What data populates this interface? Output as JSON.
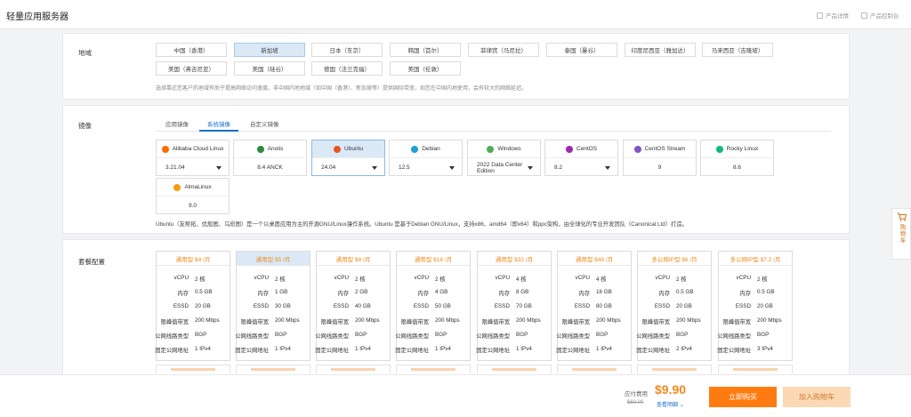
{
  "header": {
    "title": "轻量应用服务器",
    "links": [
      "产品详情",
      "产品控制台"
    ]
  },
  "region": {
    "label": "地域",
    "options": [
      "中国（香港）",
      "新加坡",
      "日本（东京）",
      "韩国（首尔）",
      "菲律宾（马尼拉）",
      "泰国（曼谷）",
      "印度尼西亚（雅加达）",
      "马来西亚（吉隆坡）",
      "美国（弗吉尼亚）",
      "美国（硅谷）",
      "德国（法兰克福）",
      "美国（伦敦）"
    ],
    "selected": "新加坡",
    "hint": "选择靠近您客户的地域有助于提高网络访问速度。非中国内地地域（如中国（香港）、新加坡等）提供国际带宽，如您在中国内地使用，会有较大的网络延迟。"
  },
  "image": {
    "label": "镜像",
    "tabs": [
      "应用镜像",
      "系统镜像",
      "自定义镜像"
    ],
    "active_tab": "系统镜像",
    "items": [
      {
        "name": "Alibaba Cloud Linux",
        "version": "3.21.04",
        "dropdown": true,
        "icon": "alibaba-cloud-logo",
        "color": "#ff6a00"
      },
      {
        "name": "Anolis",
        "version": "8.4 ANCK",
        "dropdown": false,
        "icon": "anolis-logo",
        "color": "#2b8a3e"
      },
      {
        "name": "Ubuntu",
        "version": "24.04",
        "dropdown": true,
        "icon": "ubuntu-logo",
        "color": "#e95420",
        "selected": true
      },
      {
        "name": "Debian",
        "version": "12.5",
        "dropdown": true,
        "icon": "debian-logo",
        "color": "#1da1d6"
      },
      {
        "name": "Windows",
        "version": "2022 Data Center Edition",
        "dropdown": true,
        "icon": "windows-logo",
        "color": "#4caf50"
      },
      {
        "name": "CentOS",
        "version": "8.2",
        "dropdown": true,
        "icon": "centos-logo",
        "color": "#9c27b0"
      },
      {
        "name": "CentOS Stream",
        "version": "9",
        "dropdown": false,
        "icon": "centos-stream-logo",
        "color": "#7e57c2"
      },
      {
        "name": "Rocky Linux",
        "version": "8.6",
        "dropdown": false,
        "icon": "rocky-linux-logo",
        "color": "#10b981"
      },
      {
        "name": "AlmaLinux",
        "version": "9.0",
        "dropdown": false,
        "icon": "almalinux-logo",
        "color": "#f59e0b"
      }
    ],
    "description": "Ubuntu（友帮拓、优般图、乌班图）是一个以桌面应用为主的开源GNU/Linux操作系统。Ubuntu 是基于Debian GNU/Linux，支持x86、amd64（即x64）和ppc架构，由全球化的专业开发团队（Canonical Ltd）打造。"
  },
  "plans": {
    "label": "套餐配置",
    "row_keys": [
      "vCPU",
      "内存",
      "ESSD",
      "限峰值带宽",
      "公网线路类型",
      "固定公网地址"
    ],
    "items": [
      {
        "title": "通用型 $4 /月",
        "vals": [
          "2 核",
          "0.5 GB",
          "20 GB",
          "200 Mbps",
          "BGP",
          "1 IPv4"
        ]
      },
      {
        "title": "通用型 $5 /月",
        "vals": [
          "2 核",
          "1 GB",
          "30 GB",
          "200 Mbps",
          "BGP",
          "1 IPv4"
        ],
        "selected": true
      },
      {
        "title": "通用型 $8 /月",
        "vals": [
          "2 核",
          "2 GB",
          "40 GB",
          "200 Mbps",
          "BGP",
          "1 IPv4"
        ]
      },
      {
        "title": "通用型 $16 /月",
        "vals": [
          "2 核",
          "4 GB",
          "50 GB",
          "200 Mbps",
          "BGP",
          "1 IPv4"
        ]
      },
      {
        "title": "通用型 $32 /月",
        "vals": [
          "4 核",
          "8 GB",
          "70 GB",
          "200 Mbps",
          "BGP",
          "1 IPv4"
        ]
      },
      {
        "title": "通用型 $48 /月",
        "vals": [
          "4 核",
          "16 GB",
          "80 GB",
          "200 Mbps",
          "BGP",
          "1 IPv4"
        ]
      },
      {
        "title": "多公网IP型 $6 /月",
        "vals": [
          "2 核",
          "0.5 GB",
          "20 GB",
          "200 Mbps",
          "BGP",
          "2 IPv4"
        ]
      },
      {
        "title": "多公网IP型 $7.2 /月",
        "vals": [
          "2 核",
          "0.5 GB",
          "20 GB",
          "200 Mbps",
          "BGP",
          "3 IPv4"
        ]
      }
    ]
  },
  "footer": {
    "fee_label": "应付费用",
    "price": "$9.90",
    "original_price": "$60.00",
    "detail_link": "查看明细",
    "buy_label": "立即购买",
    "cart_label": "加入购物车"
  },
  "side_cart": {
    "label": "购物车"
  }
}
